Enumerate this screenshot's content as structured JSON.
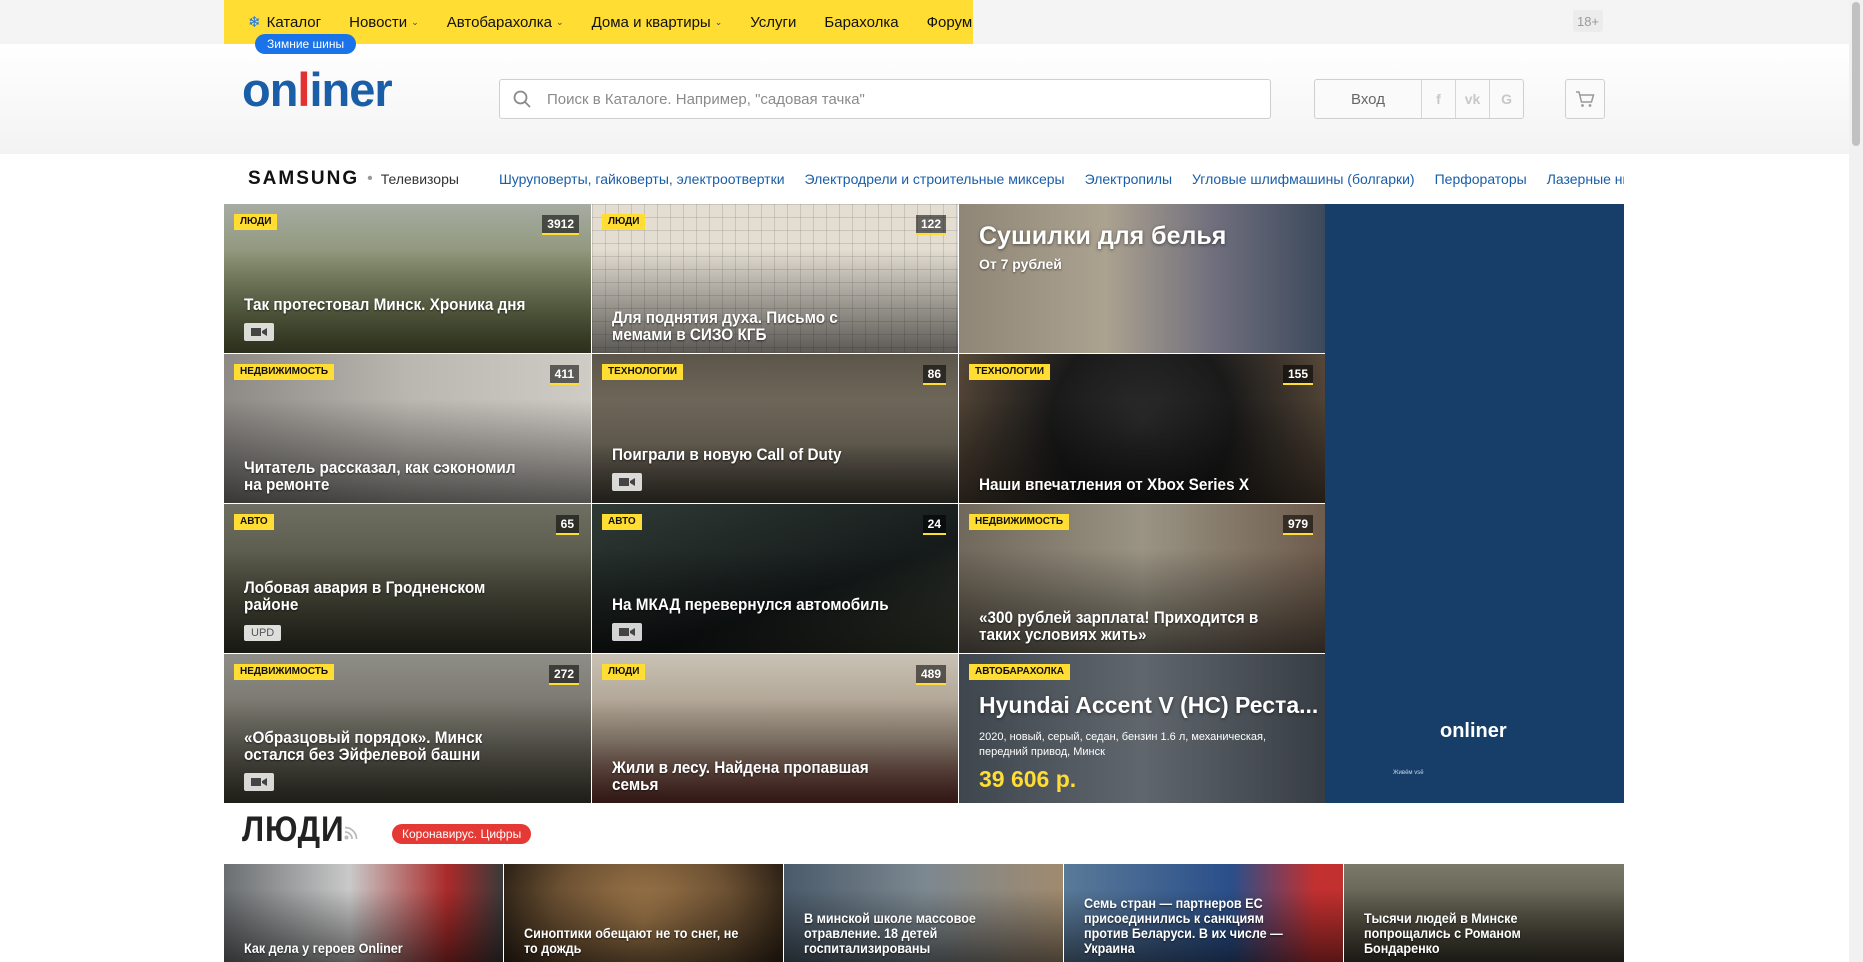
{
  "topnav": {
    "items": [
      {
        "label": "Каталог",
        "icon": "snowflake-icon"
      },
      {
        "label": "Новости",
        "has_menu": true
      },
      {
        "label": "Автобарахолка",
        "has_menu": true
      },
      {
        "label": "Дома и квартиры",
        "has_menu": true
      },
      {
        "label": "Услуги"
      },
      {
        "label": "Барахолка"
      },
      {
        "label": "Форум"
      }
    ],
    "promo_badge": "Зимние шины",
    "age_label": "18+"
  },
  "header": {
    "logo": {
      "part1": "on",
      "part2": "l",
      "part3": "iner"
    },
    "search_placeholder": "Поиск в Каталоге. Например, \"садовая тачка\"",
    "login_label": "Вход",
    "social": [
      "f",
      "vk",
      "G"
    ],
    "cart_icon": "cart-icon"
  },
  "brandbar": {
    "brand": "SAMSUNG",
    "brand_item": "Телевизоры",
    "links": [
      "Шуруповерты, гайковерты, электроотвертки",
      "Электродрели и строительные миксеры",
      "Электропилы",
      "Угловые шлифмашины (болгарки)",
      "Перфораторы",
      "Лазерные нивелиры"
    ]
  },
  "news": [
    {
      "tag": "ЛЮДИ",
      "count": "3912",
      "title": "Так протестовал Минск. Хроника дня",
      "badge": "video"
    },
    {
      "tag": "ЛЮДИ",
      "count": "122",
      "title": "Для поднятия духа. Письмо с мемами в СИЗО КГБ"
    },
    {
      "ad": true,
      "title": "Сушилки для белья",
      "subtitle": "От 7 рублей"
    },
    {
      "tag": "НЕДВИЖИМОСТЬ",
      "count": "411",
      "title": "Читатель рассказал, как сэкономил на ремонте"
    },
    {
      "tag": "ТЕХНОЛОГИИ",
      "count": "86",
      "title": "Поиграли в новую Call of Duty",
      "badge": "video"
    },
    {
      "tag": "ТЕХНОЛОГИИ",
      "count": "155",
      "title": "Наши впечатления от Xbox Series X"
    },
    {
      "tag": "АВТО",
      "count": "65",
      "title": "Лобовая авария в Гродненском районе",
      "badge": "UPD"
    },
    {
      "tag": "АВТО",
      "count": "24",
      "title": "На МКАД перевернулся автомобиль",
      "badge": "video"
    },
    {
      "tag": "НЕДВИЖИМОСТЬ",
      "count": "979",
      "title": "«300 рублей зарплата! Приходится в таких условиях жить»"
    },
    {
      "tag": "НЕДВИЖИМОСТЬ",
      "count": "272",
      "title": "«Образцовый порядок». Минск остался без Эйфелевой башни",
      "badge": "video"
    },
    {
      "tag": "ЛЮДИ",
      "count": "489",
      "title": "Жили в лесу. Найдена пропавшая семья"
    },
    {
      "tag": "АВТОБАРАХОЛКА",
      "title": "Hyundai Accent V (HC) Реста...",
      "specs": "2020, новый, серый, седан, бензин 1.6 л, механическая, передний привод, Минск",
      "price": "39 606 р."
    }
  ],
  "banner": {
    "logo": "onliner",
    "small": "Живём vsë"
  },
  "section": {
    "title": "ЛЮДИ",
    "pill": "Коронавирус. Цифры"
  },
  "strip": [
    {
      "title": "Как дела у героев Onliner"
    },
    {
      "title": "Синоптики обещают не то снег, не то дождь"
    },
    {
      "title": "В минской школе массовое отравление. 18 детей госпитализированы"
    },
    {
      "title": "Семь стран — партнеров ЕС присоединились к санкциям против Беларуси. В их числе — Украина"
    },
    {
      "title": "Тысячи людей в Минске попрощались с Романом Бондаренко"
    }
  ],
  "colors": {
    "accent_yellow": "#ffdd33",
    "brand_blue": "#1a5ea8",
    "badge_blue": "#1a73e8",
    "covid_red": "#e53935"
  }
}
